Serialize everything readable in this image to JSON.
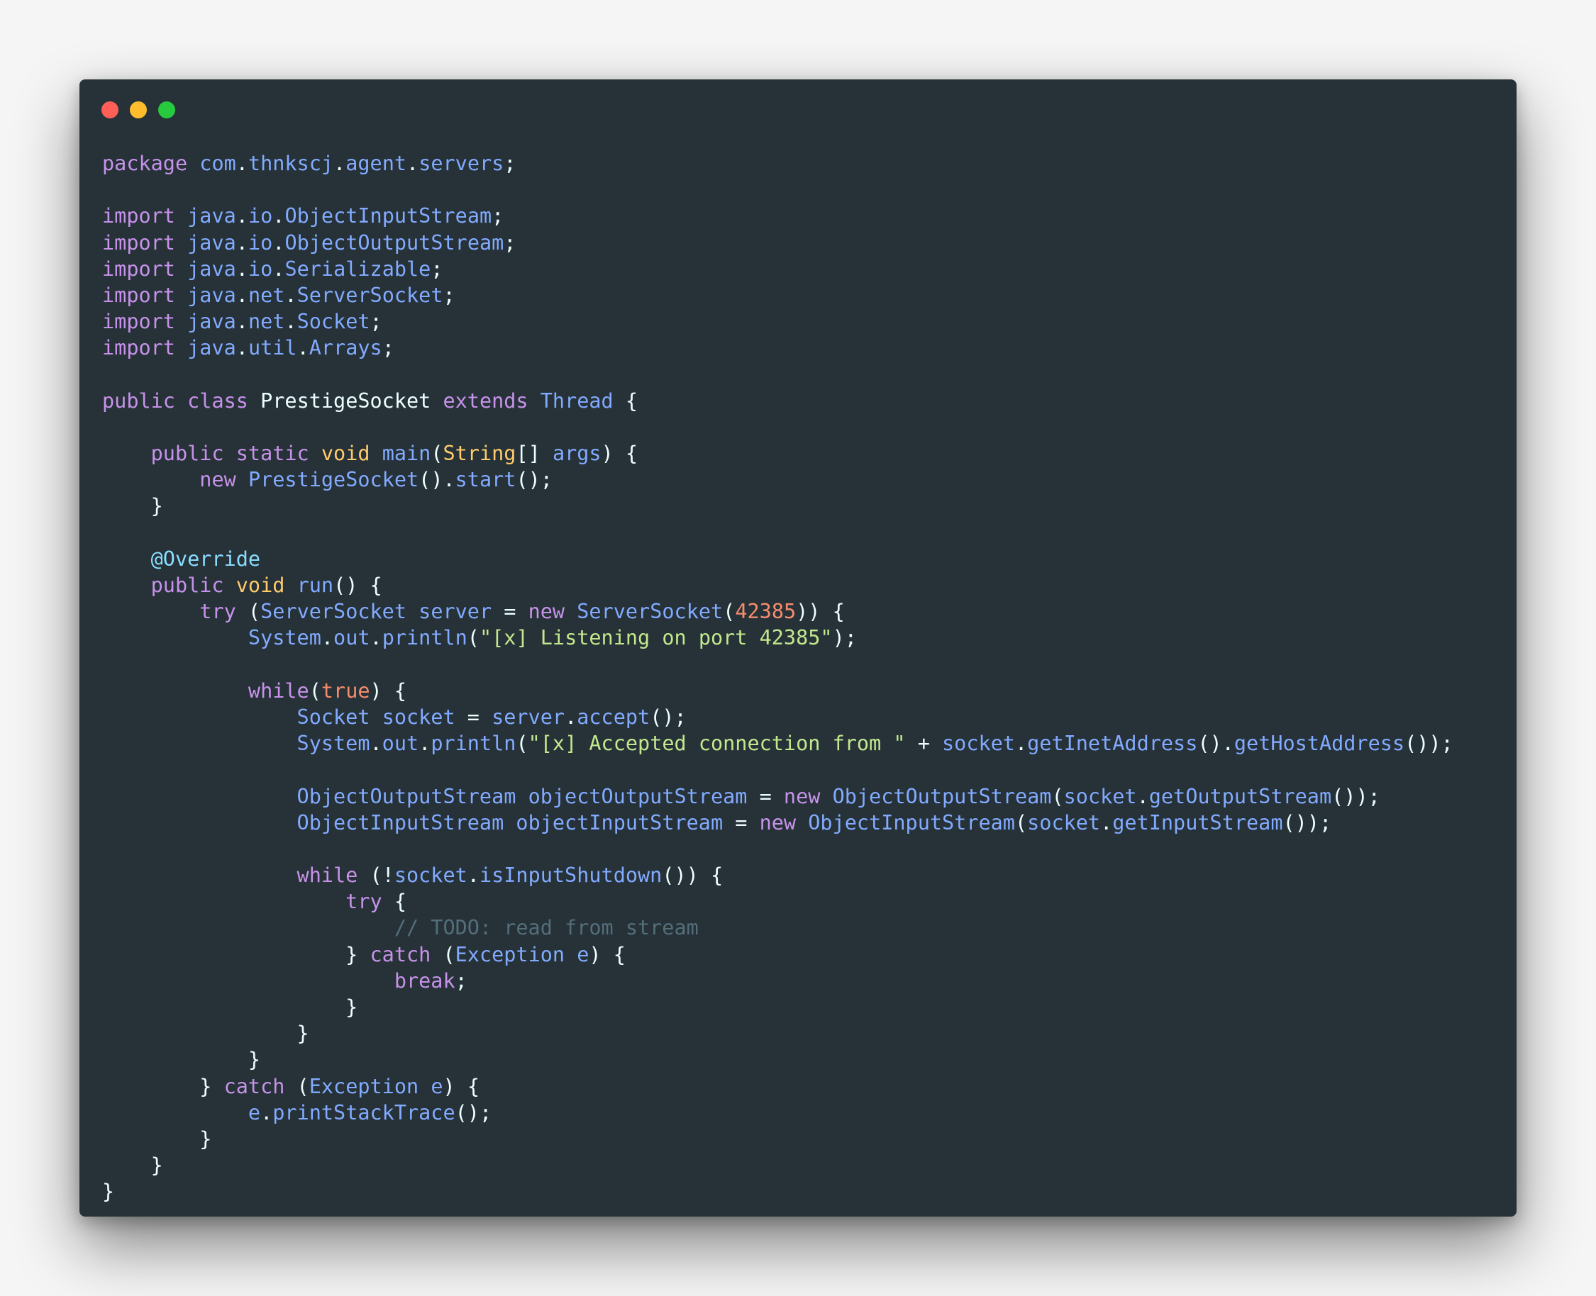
{
  "window": {
    "buttons": [
      {
        "name": "close",
        "color": "#ff5f56"
      },
      {
        "name": "minimize",
        "color": "#ffbd2e"
      },
      {
        "name": "zoom",
        "color": "#27c93f"
      }
    ]
  },
  "theme": {
    "background": "#263238",
    "keyword": "#c792ea",
    "type": "#82aaff",
    "string": "#c3e88d",
    "number": "#f78c6c",
    "annotation": "#89ddff",
    "primitive": "#ffcb6b",
    "comment": "#546e7a",
    "plain": "#eeffff"
  },
  "code_lines": [
    [
      [
        "kw",
        "package"
      ],
      [
        "plain",
        " "
      ],
      [
        "type",
        "com"
      ],
      [
        "plain",
        "."
      ],
      [
        "type",
        "thnkscj"
      ],
      [
        "plain",
        "."
      ],
      [
        "type",
        "agent"
      ],
      [
        "plain",
        "."
      ],
      [
        "type",
        "servers"
      ],
      [
        "plain",
        ";"
      ]
    ],
    [],
    [
      [
        "kw",
        "import"
      ],
      [
        "plain",
        " "
      ],
      [
        "type",
        "java"
      ],
      [
        "plain",
        "."
      ],
      [
        "type",
        "io"
      ],
      [
        "plain",
        "."
      ],
      [
        "type",
        "ObjectInputStream"
      ],
      [
        "plain",
        ";"
      ]
    ],
    [
      [
        "kw",
        "import"
      ],
      [
        "plain",
        " "
      ],
      [
        "type",
        "java"
      ],
      [
        "plain",
        "."
      ],
      [
        "type",
        "io"
      ],
      [
        "plain",
        "."
      ],
      [
        "type",
        "ObjectOutputStream"
      ],
      [
        "plain",
        ";"
      ]
    ],
    [
      [
        "kw",
        "import"
      ],
      [
        "plain",
        " "
      ],
      [
        "type",
        "java"
      ],
      [
        "plain",
        "."
      ],
      [
        "type",
        "io"
      ],
      [
        "plain",
        "."
      ],
      [
        "type",
        "Serializable"
      ],
      [
        "plain",
        ";"
      ]
    ],
    [
      [
        "kw",
        "import"
      ],
      [
        "plain",
        " "
      ],
      [
        "type",
        "java"
      ],
      [
        "plain",
        "."
      ],
      [
        "type",
        "net"
      ],
      [
        "plain",
        "."
      ],
      [
        "type",
        "ServerSocket"
      ],
      [
        "plain",
        ";"
      ]
    ],
    [
      [
        "kw",
        "import"
      ],
      [
        "plain",
        " "
      ],
      [
        "type",
        "java"
      ],
      [
        "plain",
        "."
      ],
      [
        "type",
        "net"
      ],
      [
        "plain",
        "."
      ],
      [
        "type",
        "Socket"
      ],
      [
        "plain",
        ";"
      ]
    ],
    [
      [
        "kw",
        "import"
      ],
      [
        "plain",
        " "
      ],
      [
        "type",
        "java"
      ],
      [
        "plain",
        "."
      ],
      [
        "type",
        "util"
      ],
      [
        "plain",
        "."
      ],
      [
        "type",
        "Arrays"
      ],
      [
        "plain",
        ";"
      ]
    ],
    [],
    [
      [
        "kw",
        "public"
      ],
      [
        "plain",
        " "
      ],
      [
        "kw",
        "class"
      ],
      [
        "plain",
        " "
      ],
      [
        "cls",
        "PrestigeSocket"
      ],
      [
        "plain",
        " "
      ],
      [
        "kw",
        "extends"
      ],
      [
        "plain",
        " "
      ],
      [
        "type",
        "Thread"
      ],
      [
        "plain",
        " {"
      ]
    ],
    [],
    [
      [
        "plain",
        "    "
      ],
      [
        "kw",
        "public"
      ],
      [
        "plain",
        " "
      ],
      [
        "kw",
        "static"
      ],
      [
        "plain",
        " "
      ],
      [
        "prim",
        "void"
      ],
      [
        "plain",
        " "
      ],
      [
        "fn",
        "main"
      ],
      [
        "plain",
        "("
      ],
      [
        "prim",
        "String"
      ],
      [
        "plain",
        "[] "
      ],
      [
        "type",
        "args"
      ],
      [
        "plain",
        ") {"
      ]
    ],
    [
      [
        "plain",
        "        "
      ],
      [
        "kw",
        "new"
      ],
      [
        "plain",
        " "
      ],
      [
        "type",
        "PrestigeSocket"
      ],
      [
        "plain",
        "()."
      ],
      [
        "fn",
        "start"
      ],
      [
        "plain",
        "();"
      ]
    ],
    [
      [
        "plain",
        "    }"
      ]
    ],
    [],
    [
      [
        "plain",
        "    "
      ],
      [
        "ann",
        "@Override"
      ]
    ],
    [
      [
        "plain",
        "    "
      ],
      [
        "kw",
        "public"
      ],
      [
        "plain",
        " "
      ],
      [
        "prim",
        "void"
      ],
      [
        "plain",
        " "
      ],
      [
        "fn",
        "run"
      ],
      [
        "plain",
        "() {"
      ]
    ],
    [
      [
        "plain",
        "        "
      ],
      [
        "kw",
        "try"
      ],
      [
        "plain",
        " ("
      ],
      [
        "type",
        "ServerSocket"
      ],
      [
        "plain",
        " "
      ],
      [
        "type",
        "server"
      ],
      [
        "plain",
        " = "
      ],
      [
        "kw",
        "new"
      ],
      [
        "plain",
        " "
      ],
      [
        "type",
        "ServerSocket"
      ],
      [
        "plain",
        "("
      ],
      [
        "num",
        "42385"
      ],
      [
        "plain",
        ")) {"
      ]
    ],
    [
      [
        "plain",
        "            "
      ],
      [
        "type",
        "System"
      ],
      [
        "plain",
        "."
      ],
      [
        "type",
        "out"
      ],
      [
        "plain",
        "."
      ],
      [
        "fn",
        "println"
      ],
      [
        "plain",
        "("
      ],
      [
        "str",
        "\"[x] Listening on port 42385\""
      ],
      [
        "plain",
        ");"
      ]
    ],
    [],
    [
      [
        "plain",
        "            "
      ],
      [
        "kw",
        "while"
      ],
      [
        "plain",
        "("
      ],
      [
        "bool",
        "true"
      ],
      [
        "plain",
        ") {"
      ]
    ],
    [
      [
        "plain",
        "                "
      ],
      [
        "type",
        "Socket"
      ],
      [
        "plain",
        " "
      ],
      [
        "type",
        "socket"
      ],
      [
        "plain",
        " = "
      ],
      [
        "type",
        "server"
      ],
      [
        "plain",
        "."
      ],
      [
        "fn",
        "accept"
      ],
      [
        "plain",
        "();"
      ]
    ],
    [
      [
        "plain",
        "                "
      ],
      [
        "type",
        "System"
      ],
      [
        "plain",
        "."
      ],
      [
        "type",
        "out"
      ],
      [
        "plain",
        "."
      ],
      [
        "fn",
        "println"
      ],
      [
        "plain",
        "("
      ],
      [
        "str",
        "\"[x] Accepted connection from \""
      ],
      [
        "plain",
        " + "
      ],
      [
        "type",
        "socket"
      ],
      [
        "plain",
        "."
      ],
      [
        "fn",
        "getInetAddress"
      ],
      [
        "plain",
        "()."
      ],
      [
        "fn",
        "getHostAddress"
      ],
      [
        "plain",
        "());"
      ]
    ],
    [],
    [
      [
        "plain",
        "                "
      ],
      [
        "type",
        "ObjectOutputStream"
      ],
      [
        "plain",
        " "
      ],
      [
        "type",
        "objectOutputStream"
      ],
      [
        "plain",
        " = "
      ],
      [
        "kw",
        "new"
      ],
      [
        "plain",
        " "
      ],
      [
        "type",
        "ObjectOutputStream"
      ],
      [
        "plain",
        "("
      ],
      [
        "type",
        "socket"
      ],
      [
        "plain",
        "."
      ],
      [
        "fn",
        "getOutputStream"
      ],
      [
        "plain",
        "());"
      ]
    ],
    [
      [
        "plain",
        "                "
      ],
      [
        "type",
        "ObjectInputStream"
      ],
      [
        "plain",
        " "
      ],
      [
        "type",
        "objectInputStream"
      ],
      [
        "plain",
        " = "
      ],
      [
        "kw",
        "new"
      ],
      [
        "plain",
        " "
      ],
      [
        "type",
        "ObjectInputStream"
      ],
      [
        "plain",
        "("
      ],
      [
        "type",
        "socket"
      ],
      [
        "plain",
        "."
      ],
      [
        "fn",
        "getInputStream"
      ],
      [
        "plain",
        "());"
      ]
    ],
    [],
    [
      [
        "plain",
        "                "
      ],
      [
        "kw",
        "while"
      ],
      [
        "plain",
        " (!"
      ],
      [
        "type",
        "socket"
      ],
      [
        "plain",
        "."
      ],
      [
        "fn",
        "isInputShutdown"
      ],
      [
        "plain",
        "()) {"
      ]
    ],
    [
      [
        "plain",
        "                    "
      ],
      [
        "kw",
        "try"
      ],
      [
        "plain",
        " {"
      ]
    ],
    [
      [
        "plain",
        "                        "
      ],
      [
        "com",
        "// TODO: read from stream"
      ]
    ],
    [
      [
        "plain",
        "                    } "
      ],
      [
        "kw",
        "catch"
      ],
      [
        "plain",
        " ("
      ],
      [
        "type",
        "Exception"
      ],
      [
        "plain",
        " "
      ],
      [
        "type",
        "e"
      ],
      [
        "plain",
        ") {"
      ]
    ],
    [
      [
        "plain",
        "                        "
      ],
      [
        "kw",
        "break"
      ],
      [
        "plain",
        ";"
      ]
    ],
    [
      [
        "plain",
        "                    }"
      ]
    ],
    [
      [
        "plain",
        "                }"
      ]
    ],
    [
      [
        "plain",
        "            }"
      ]
    ],
    [
      [
        "plain",
        "        } "
      ],
      [
        "kw",
        "catch"
      ],
      [
        "plain",
        " ("
      ],
      [
        "type",
        "Exception"
      ],
      [
        "plain",
        " "
      ],
      [
        "type",
        "e"
      ],
      [
        "plain",
        ") {"
      ]
    ],
    [
      [
        "plain",
        "            "
      ],
      [
        "type",
        "e"
      ],
      [
        "plain",
        "."
      ],
      [
        "fn",
        "printStackTrace"
      ],
      [
        "plain",
        "();"
      ]
    ],
    [
      [
        "plain",
        "        }"
      ]
    ],
    [
      [
        "plain",
        "    }"
      ]
    ],
    [
      [
        "plain",
        "}"
      ]
    ]
  ]
}
